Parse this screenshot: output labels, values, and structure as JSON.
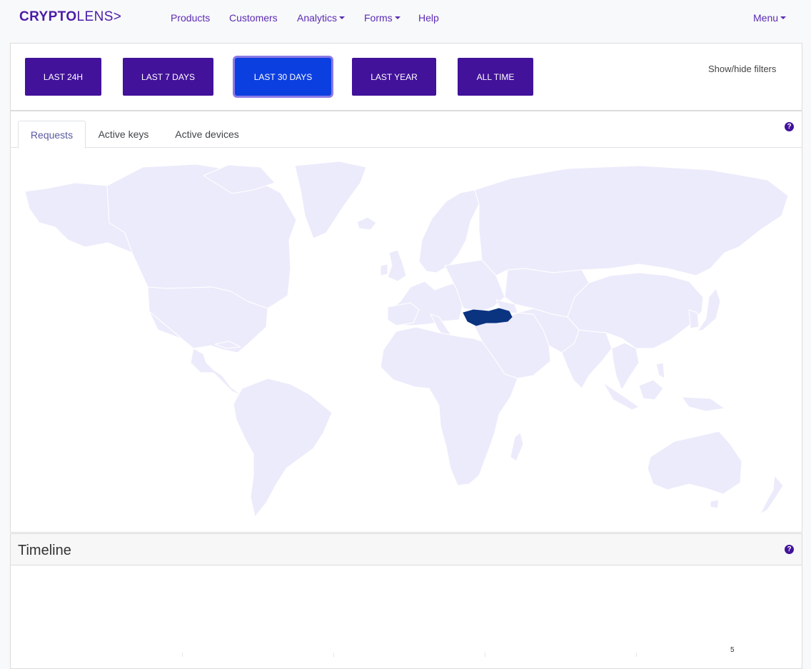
{
  "brand": {
    "part1": "CRYPTO",
    "part2": "LENS>"
  },
  "nav": {
    "products": "Products",
    "customers": "Customers",
    "analytics": "Analytics",
    "forms": "Forms",
    "help": "Help",
    "menu": "Menu"
  },
  "filters": {
    "buttons": [
      "LAST 24H",
      "LAST 7 DAYS",
      "LAST 30 DAYS",
      "LAST YEAR",
      "ALL TIME"
    ],
    "active": "LAST 30 DAYS",
    "show_hide": "Show/hide filters"
  },
  "tabs": [
    "Requests",
    "Active keys",
    "Active devices"
  ],
  "active_tab": "Requests",
  "map": {
    "highlighted_country": "Turkey",
    "highlight_color": "#0a3380",
    "land_color": "#ecebfb",
    "border_color": "#ffffff"
  },
  "timeline": {
    "title": "Timeline",
    "visible_tick": "5"
  },
  "colors": {
    "primary": "#42129a",
    "active_button": "#0c3fe0",
    "link": "#5b2bb6"
  },
  "icons": {
    "help": "question-circle-icon"
  }
}
